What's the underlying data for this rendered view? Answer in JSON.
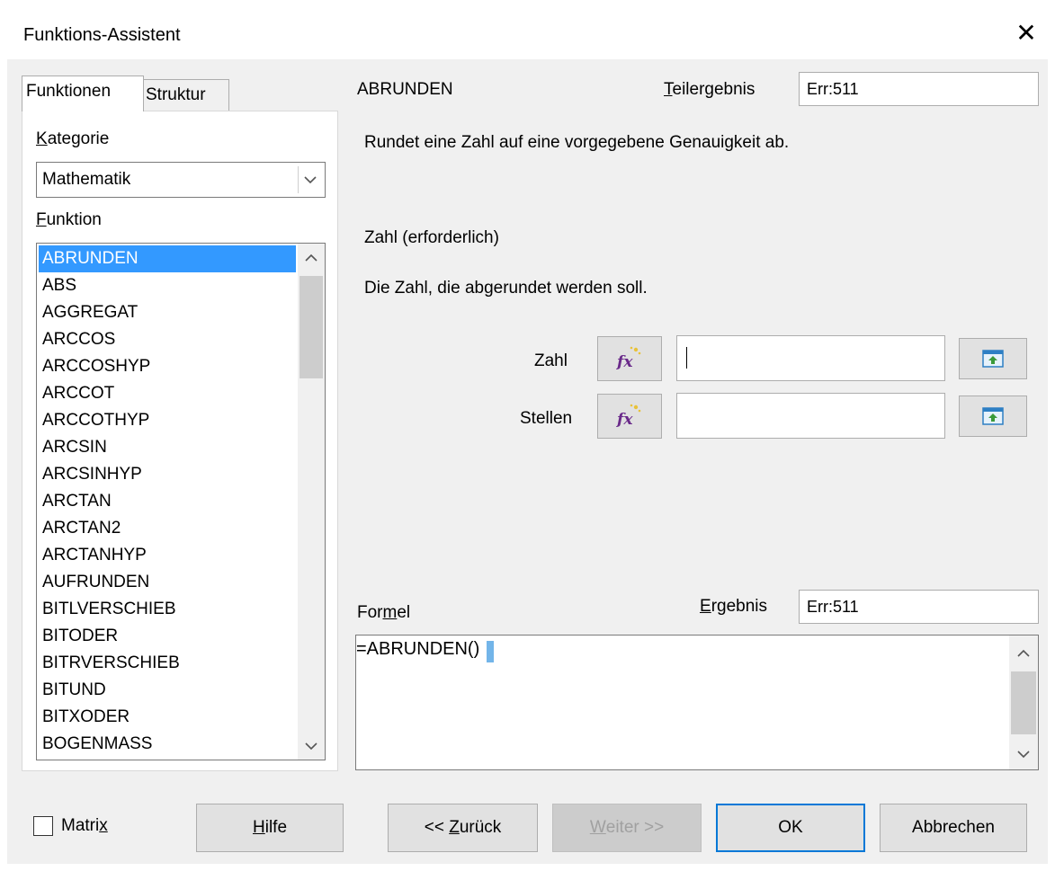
{
  "window": {
    "title": "Funktions-Assistent",
    "close_glyph": "✕"
  },
  "tabs": [
    {
      "label": "Funktionen"
    },
    {
      "label": "Struktur"
    }
  ],
  "category": {
    "label_first": "K",
    "label_rest": "ategorie",
    "selected": "Mathematik"
  },
  "functions": {
    "label_first": "F",
    "label_rest": "unktion",
    "items": [
      "ABRUNDEN",
      "ABS",
      "AGGREGAT",
      "ARCCOS",
      "ARCCOSHYP",
      "ARCCOT",
      "ARCCOTHYP",
      "ARCSIN",
      "ARCSINHYP",
      "ARCTAN",
      "ARCTAN2",
      "ARCTANHYP",
      "AUFRUNDEN",
      "BITLVERSCHIEB",
      "BITODER",
      "BITRVERSCHIEB",
      "BITUND",
      "BITXODER",
      "BOGENMASS"
    ],
    "selected_index": 0
  },
  "detail": {
    "function_name": "ABRUNDEN",
    "partial_label_first": "T",
    "partial_label_rest": "eilergebnis",
    "partial_value": "Err:511",
    "description": "Rundet eine Zahl auf eine vorgegebene Genauigkeit ab.",
    "argument_title": "Zahl (erforderlich)",
    "argument_description": "Die Zahl, die abgerundet werden soll."
  },
  "arguments": [
    {
      "label": "Zahl",
      "value": ""
    },
    {
      "label": "Stellen",
      "value": ""
    }
  ],
  "formula": {
    "label_a": "For",
    "label_u": "m",
    "label_b": "el",
    "result_label_first": "E",
    "result_label_rest": "rgebnis",
    "result_value": "Err:511",
    "text": "=ABRUNDEN()"
  },
  "footer": {
    "matrix_a": "Matri",
    "matrix_u": "x",
    "help_u": "H",
    "help_rest": "ilfe",
    "back_a": "<< ",
    "back_u": "Z",
    "back_rest": "urück",
    "next_u": "W",
    "next_rest": "eiter >>",
    "ok": "OK",
    "cancel": "Abbrechen",
    "matrix_checked": false
  },
  "colors": {
    "selection": "#3399ff",
    "default_button_border": "#0078d7"
  },
  "icons": [
    "close-icon",
    "chevron-down-icon",
    "chevron-up-icon",
    "function-wizard-icon",
    "shrink-dialog-icon"
  ]
}
